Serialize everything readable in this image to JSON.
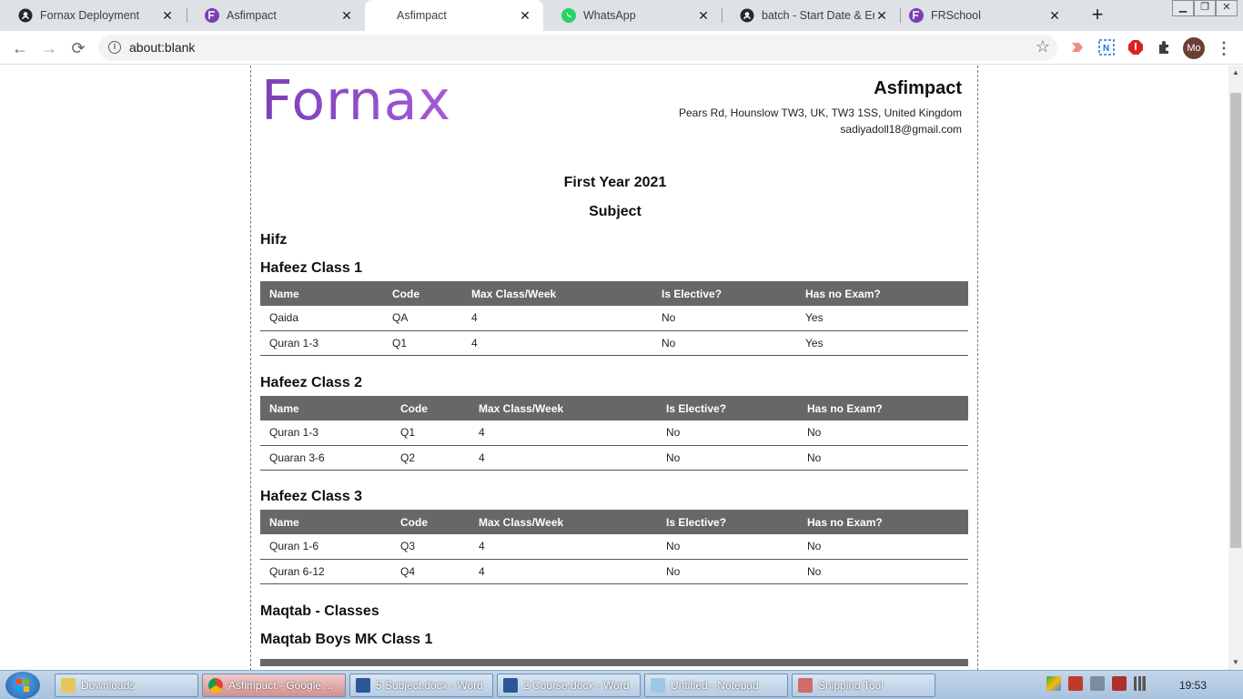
{
  "browser": {
    "tabs": [
      {
        "title": "Fornax Deployment",
        "icon": "github-icon"
      },
      {
        "title": "Asfimpact",
        "icon": "fornax-icon"
      },
      {
        "title": "Asfimpact",
        "icon": "none",
        "active": true
      },
      {
        "title": "WhatsApp",
        "icon": "whatsapp-icon"
      },
      {
        "title": "batch - Start Date & End",
        "icon": "github-icon"
      },
      {
        "title": "FRSchool",
        "icon": "fornax-icon"
      }
    ],
    "new_tab": "+",
    "url": "about:blank",
    "profile_initials": "Mo"
  },
  "document": {
    "logo_text": "Fornax",
    "company_name": "Asfimpact",
    "address": "Pears Rd, Hounslow TW3, UK, TW3 1SS, United Kingdom",
    "email": "sadiyadoll18@gmail.com",
    "year_title": "First Year 2021",
    "subject_title": "Subject",
    "columns": [
      "Name",
      "Code",
      "Max Class/Week",
      "Is Elective?",
      "Has no Exam?"
    ],
    "sections": [
      {
        "heading": "Hifz",
        "classes": [
          {
            "name": "Hafeez Class 1",
            "rows": [
              [
                "Qaida",
                "QA",
                "4",
                "No",
                "Yes"
              ],
              [
                "Quran 1-3",
                "Q1",
                "4",
                "No",
                "Yes"
              ]
            ]
          },
          {
            "name": "Hafeez Class 2",
            "rows": [
              [
                "Quran 1-3",
                "Q1",
                "4",
                "No",
                "No"
              ],
              [
                "Quaran 3-6",
                "Q2",
                "4",
                "No",
                "No"
              ]
            ]
          },
          {
            "name": "Hafeez Class 3",
            "rows": [
              [
                "Quran 1-6",
                "Q3",
                "4",
                "No",
                "No"
              ],
              [
                "Quran 6-12",
                "Q4",
                "4",
                "No",
                "No"
              ]
            ]
          }
        ]
      },
      {
        "heading": "Maqtab - Classes",
        "classes": [
          {
            "name": "Maqtab Boys MK Class 1",
            "rows": []
          }
        ]
      }
    ]
  },
  "taskbar": {
    "items": [
      {
        "label": "Downloads",
        "icon": "folder-icon"
      },
      {
        "label": "Asfimpact - Google ...",
        "icon": "chrome-icon",
        "active": true
      },
      {
        "label": "5 Subject.docx - Word",
        "icon": "word-icon"
      },
      {
        "label": "2 Course.docx - Word",
        "icon": "word-icon"
      },
      {
        "label": "Untitled - Notepad",
        "icon": "notepad-icon"
      },
      {
        "label": "Snipping Tool",
        "icon": "snipping-tool-icon"
      }
    ],
    "clock": "19:53"
  },
  "colors": {
    "tab_strip": "#dee1e6",
    "table_header": "#676767",
    "logo": "#7a4cc3"
  }
}
